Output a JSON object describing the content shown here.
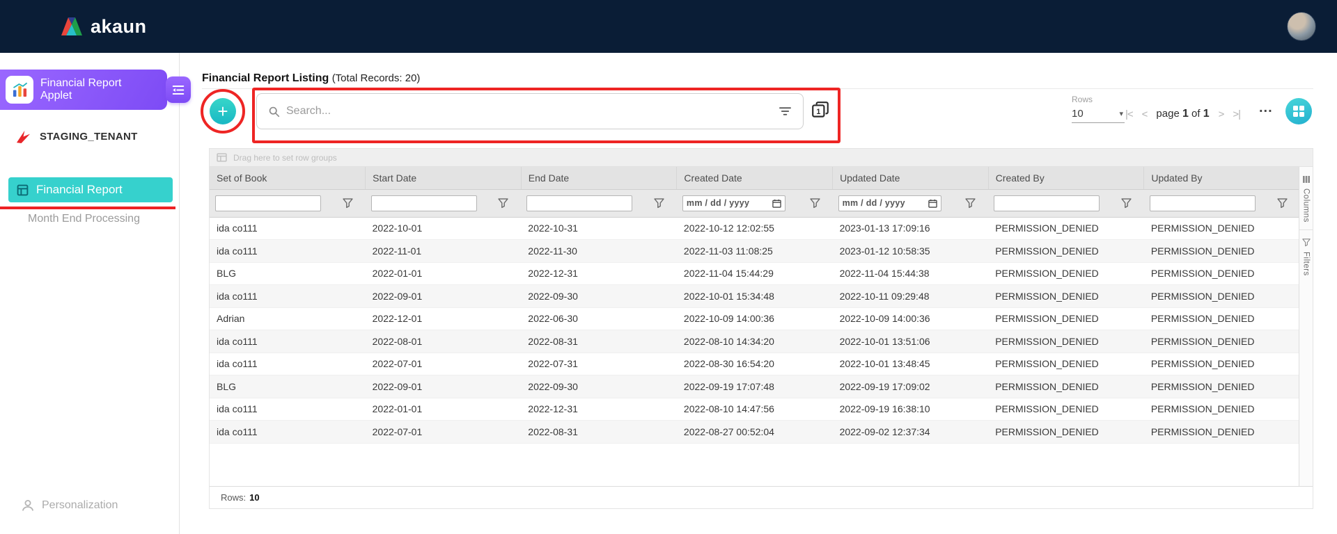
{
  "topbar": {
    "logo": "akaun"
  },
  "sidebar": {
    "applet_label": "Financial Report Applet",
    "tenant": "STAGING_TENANT",
    "financial_report": "Financial Report",
    "month_end": "Month End Processing",
    "personalization": "Personalization"
  },
  "main": {
    "title": "Financial Report Listing",
    "total_records": "(Total Records: 20)"
  },
  "toolbar": {
    "search_placeholder": "Search...",
    "rows_label": "Rows",
    "rows_value": "10",
    "pagination": {
      "page_label": "page",
      "current": "1",
      "of_label": "of",
      "total": "1"
    },
    "more_label": "..."
  },
  "table": {
    "drag_hint": "Drag here to set row groups",
    "columns": [
      "Set of Book",
      "Start Date",
      "End Date",
      "Created Date",
      "Updated Date",
      "Created By",
      "Updated By"
    ],
    "filter_types": [
      "text",
      "text",
      "text",
      "date",
      "date",
      "text",
      "text"
    ],
    "date_placeholder": "mm / dd / yyyy",
    "rows": [
      [
        "ida co111",
        "2022-10-01",
        "2022-10-31",
        "2022-10-12 12:02:55",
        "2023-01-13 17:09:16",
        "PERMISSION_DENIED",
        "PERMISSION_DENIED"
      ],
      [
        "ida co111",
        "2022-11-01",
        "2022-11-30",
        "2022-11-03 11:08:25",
        "2023-01-12 10:58:35",
        "PERMISSION_DENIED",
        "PERMISSION_DENIED"
      ],
      [
        "BLG",
        "2022-01-01",
        "2022-12-31",
        "2022-11-04 15:44:29",
        "2022-11-04 15:44:38",
        "PERMISSION_DENIED",
        "PERMISSION_DENIED"
      ],
      [
        "ida co111",
        "2022-09-01",
        "2022-09-30",
        "2022-10-01 15:34:48",
        "2022-10-11 09:29:48",
        "PERMISSION_DENIED",
        "PERMISSION_DENIED"
      ],
      [
        "Adrian",
        "2022-12-01",
        "2022-06-30",
        "2022-10-09 14:00:36",
        "2022-10-09 14:00:36",
        "PERMISSION_DENIED",
        "PERMISSION_DENIED"
      ],
      [
        "ida co111",
        "2022-08-01",
        "2022-08-31",
        "2022-08-10 14:34:20",
        "2022-10-01 13:51:06",
        "PERMISSION_DENIED",
        "PERMISSION_DENIED"
      ],
      [
        "ida co111",
        "2022-07-01",
        "2022-07-31",
        "2022-08-30 16:54:20",
        "2022-10-01 13:48:45",
        "PERMISSION_DENIED",
        "PERMISSION_DENIED"
      ],
      [
        "BLG",
        "2022-09-01",
        "2022-09-30",
        "2022-09-19 17:07:48",
        "2022-09-19 17:09:02",
        "PERMISSION_DENIED",
        "PERMISSION_DENIED"
      ],
      [
        "ida co111",
        "2022-01-01",
        "2022-12-31",
        "2022-08-10 14:47:56",
        "2022-09-19 16:38:10",
        "PERMISSION_DENIED",
        "PERMISSION_DENIED"
      ],
      [
        "ida co111",
        "2022-07-01",
        "2022-08-31",
        "2022-08-27 00:52:04",
        "2022-09-02 12:37:34",
        "PERMISSION_DENIED",
        "PERMISSION_DENIED"
      ]
    ]
  },
  "footer": {
    "rows_label": "Rows:",
    "rows_value": "10"
  },
  "side_panel": {
    "tabs": [
      {
        "label": "Columns"
      },
      {
        "label": "Filters"
      }
    ]
  },
  "colors": {
    "topbar_navy": "#0a1d36",
    "accent_purple": "#7d4bf5",
    "accent_teal": "#2fd0cb",
    "annotation_red": "#ee2524"
  }
}
